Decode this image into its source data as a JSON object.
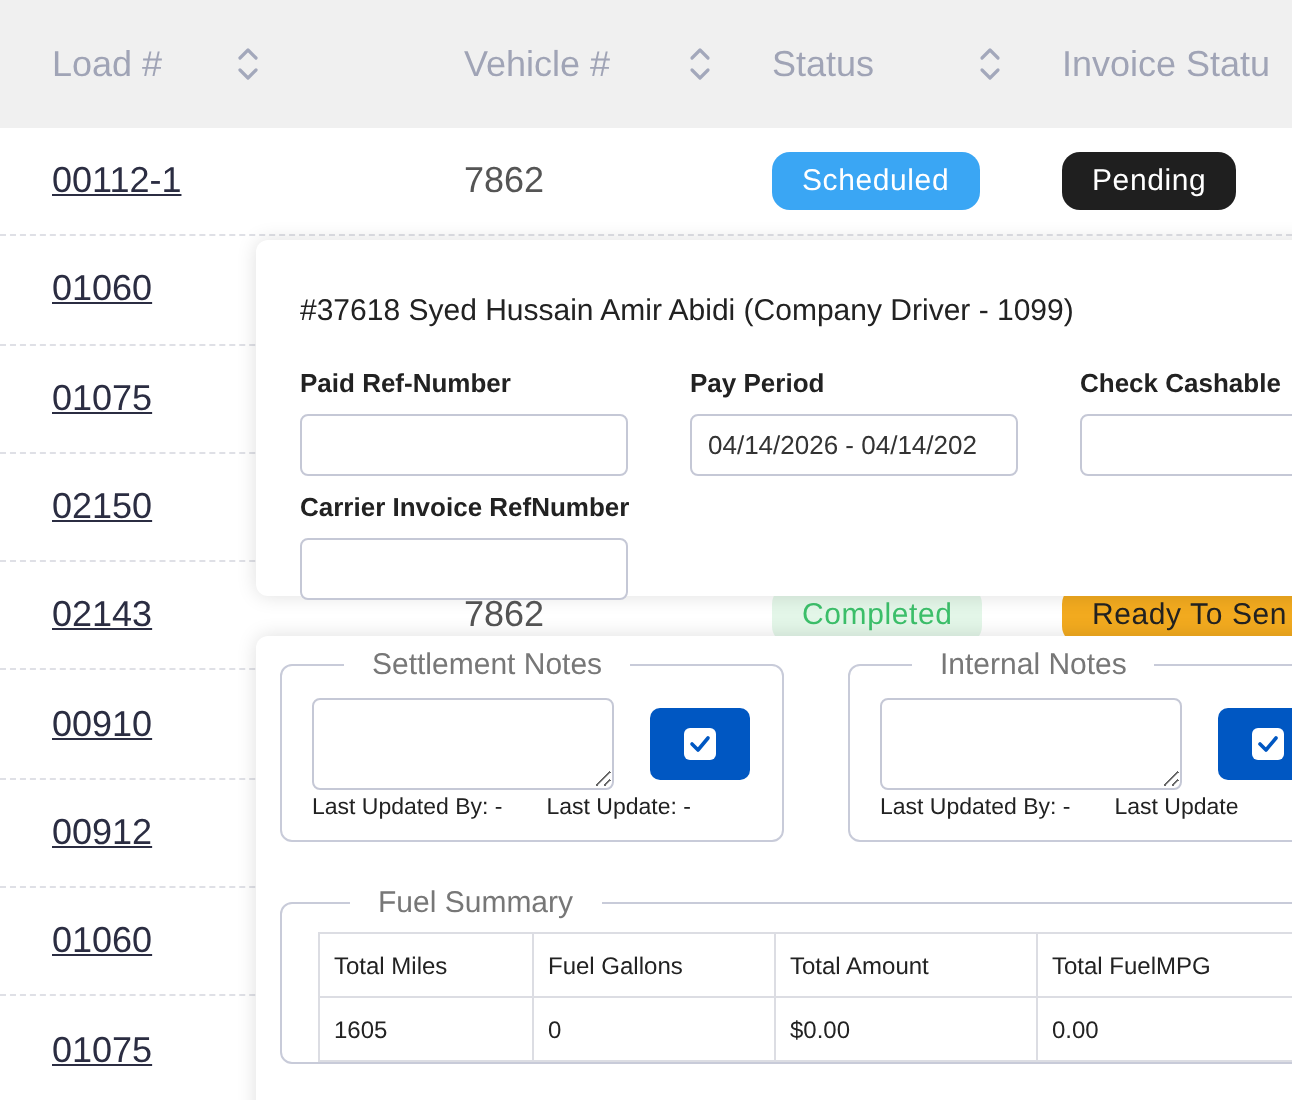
{
  "table": {
    "columns": [
      {
        "label": "Load #",
        "sortable": true
      },
      {
        "label": "Vehicle #",
        "sortable": true
      },
      {
        "label": "Status",
        "sortable": true
      },
      {
        "label": "Invoice Statu"
      }
    ],
    "rows": [
      {
        "load": "00112-1",
        "vehicle": "7862",
        "status": {
          "label": "Scheduled",
          "kind": "scheduled"
        },
        "invoice_status": {
          "label": "Pending",
          "kind": "pending"
        }
      },
      {
        "load": "01060"
      },
      {
        "load": "01075"
      },
      {
        "load": "02150"
      },
      {
        "load": "02143",
        "vehicle": "7862",
        "status": {
          "label": "Completed",
          "kind": "completed"
        },
        "invoice_status": {
          "label": "Ready To Sen",
          "kind": "ready"
        }
      },
      {
        "load": "00910"
      },
      {
        "load": "00912"
      },
      {
        "load": "01060"
      },
      {
        "load": "01075"
      }
    ]
  },
  "driver_panel": {
    "title": "#37618 Syed Hussain Amir Abidi (Company Driver - 1099)",
    "fields": [
      {
        "label": "Paid Ref-Number"
      },
      {
        "label": "Pay Period",
        "value": "04/14/2026 - 04/14/202"
      },
      {
        "label": "Check Cashable"
      },
      {
        "label": "Carrier Invoice RefNumber"
      }
    ]
  },
  "notes_panel": {
    "sections": [
      {
        "title": "Settlement Notes",
        "updated_by": "Last Updated By: -",
        "updated_at": "Last Update: -"
      },
      {
        "title": "Internal Notes",
        "updated_by": "Last Updated By: -",
        "updated_at": "Last Update"
      }
    ],
    "fuel_summary": {
      "title": "Fuel Summary",
      "columns": [
        "Total Miles",
        "Fuel Gallons",
        "Total Amount",
        "Total FuelMPG"
      ],
      "rows": [
        [
          "1605",
          "0",
          "$0.00",
          "0.00"
        ]
      ]
    }
  }
}
